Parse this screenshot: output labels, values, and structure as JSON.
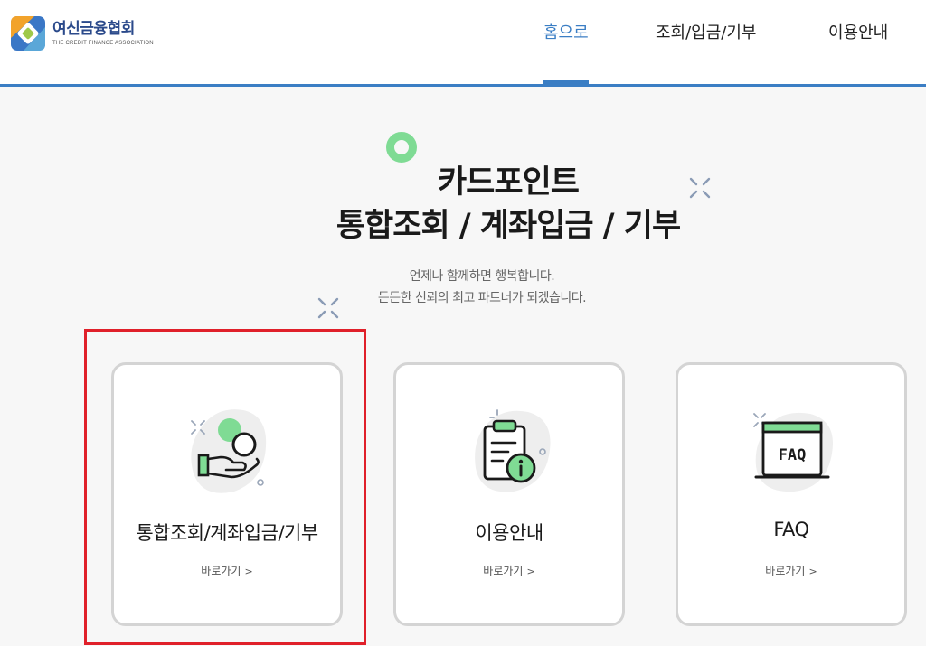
{
  "header": {
    "logo": {
      "name": "여신금융협회",
      "subtitle": "THE CREDIT FINANCE ASSOCIATION"
    },
    "nav": [
      {
        "label": "홈으로",
        "active": true
      },
      {
        "label": "조회/입금/기부",
        "active": false
      },
      {
        "label": "이용안내",
        "active": false
      }
    ]
  },
  "hero": {
    "title_line1": "카드포인트",
    "title_line2": "통합조회 / 계좌입금 / 기부",
    "subtitle_line1": "언제나 함께하면 행복합니다.",
    "subtitle_line2": "든든한 신뢰의 최고 파트너가 되겠습니다."
  },
  "cards": [
    {
      "title": "통합조회/계좌입금/기부",
      "link_label": "바로가기",
      "link_icon": "chevron-right-icon",
      "icon": "hand-coin-icon",
      "highlighted": true
    },
    {
      "title": "이용안내",
      "link_label": "바로가기",
      "link_icon": "chevron-right-icon",
      "icon": "clipboard-info-icon",
      "highlighted": false
    },
    {
      "title": "FAQ",
      "link_label": "바로가기",
      "link_icon": "chevron-right-icon",
      "icon": "faq-screen-icon",
      "highlighted": false
    }
  ],
  "colors": {
    "accent": "#3b7ec4",
    "green": "#7fdb94",
    "highlight": "#e0202a",
    "card_border": "#d4d4d4"
  }
}
